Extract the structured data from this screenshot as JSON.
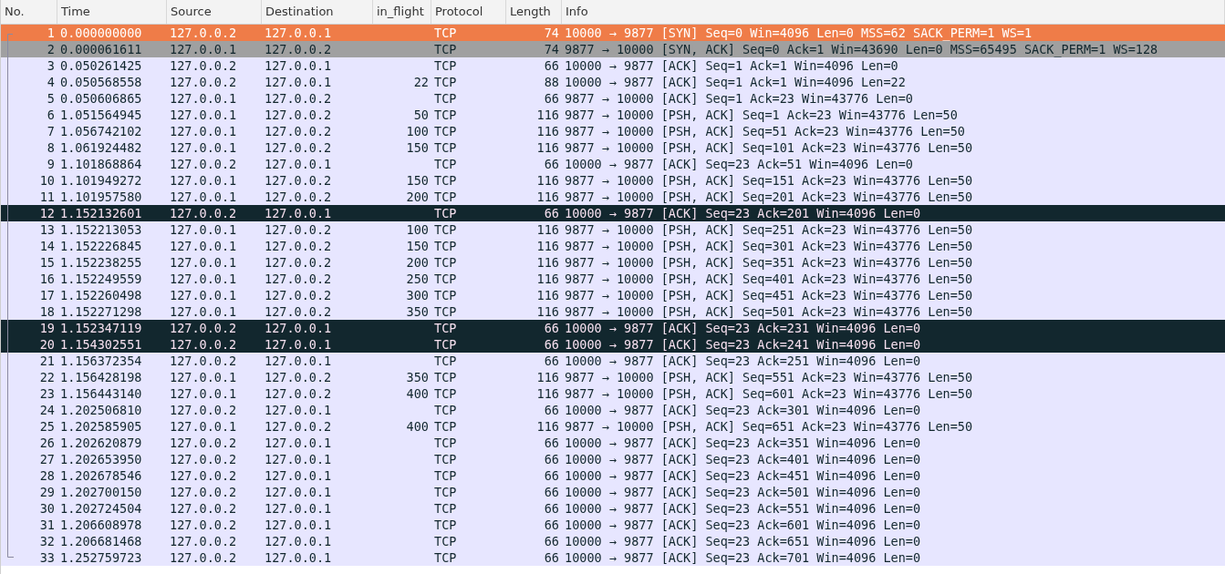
{
  "columns": [
    "No.",
    "Time",
    "Source",
    "Destination",
    "in_flight",
    "Protocol",
    "Length",
    "Info"
  ],
  "rows": [
    {
      "no": "1",
      "time": "0.000000000",
      "source": "127.0.0.2",
      "destination": "127.0.0.1",
      "in_flight": "",
      "protocol": "TCP",
      "length": "74",
      "info": "10000 → 9877 [SYN] Seq=0 Win=4096 Len=0 MSS=62 SACK_PERM=1 WS=1",
      "selected": true
    },
    {
      "no": "2",
      "time": "0.000061611",
      "source": "127.0.0.1",
      "destination": "127.0.0.2",
      "in_flight": "",
      "protocol": "TCP",
      "length": "74",
      "info": "9877 → 10000 [SYN, ACK] Seq=0 Ack=1 Win=43690 Len=0 MSS=65495 SACK_PERM=1 WS=128",
      "kind": "syn",
      "selected": false
    },
    {
      "no": "3",
      "time": "0.050261425",
      "source": "127.0.0.2",
      "destination": "127.0.0.1",
      "in_flight": "",
      "protocol": "TCP",
      "length": "66",
      "info": "10000 → 9877 [ACK] Seq=1 Ack=1 Win=4096 Len=0",
      "kind": "tcp",
      "selected": false
    },
    {
      "no": "4",
      "time": "0.050568558",
      "source": "127.0.0.2",
      "destination": "127.0.0.1",
      "in_flight": "22",
      "protocol": "TCP",
      "length": "88",
      "info": "10000 → 9877 [ACK] Seq=1 Ack=1 Win=4096 Len=22",
      "kind": "tcp",
      "selected": false
    },
    {
      "no": "5",
      "time": "0.050606865",
      "source": "127.0.0.1",
      "destination": "127.0.0.2",
      "in_flight": "",
      "protocol": "TCP",
      "length": "66",
      "info": "9877 → 10000 [ACK] Seq=1 Ack=23 Win=43776 Len=0",
      "kind": "tcp",
      "selected": false
    },
    {
      "no": "6",
      "time": "1.051564945",
      "source": "127.0.0.1",
      "destination": "127.0.0.2",
      "in_flight": "50",
      "protocol": "TCP",
      "length": "116",
      "info": "9877 → 10000 [PSH, ACK] Seq=1 Ack=23 Win=43776 Len=50",
      "kind": "tcp",
      "selected": false
    },
    {
      "no": "7",
      "time": "1.056742102",
      "source": "127.0.0.1",
      "destination": "127.0.0.2",
      "in_flight": "100",
      "protocol": "TCP",
      "length": "116",
      "info": "9877 → 10000 [PSH, ACK] Seq=51 Ack=23 Win=43776 Len=50",
      "kind": "tcp",
      "selected": false
    },
    {
      "no": "8",
      "time": "1.061924482",
      "source": "127.0.0.1",
      "destination": "127.0.0.2",
      "in_flight": "150",
      "protocol": "TCP",
      "length": "116",
      "info": "9877 → 10000 [PSH, ACK] Seq=101 Ack=23 Win=43776 Len=50",
      "kind": "tcp",
      "selected": false
    },
    {
      "no": "9",
      "time": "1.101868864",
      "source": "127.0.0.2",
      "destination": "127.0.0.1",
      "in_flight": "",
      "protocol": "TCP",
      "length": "66",
      "info": "10000 → 9877 [ACK] Seq=23 Ack=51 Win=4096 Len=0",
      "kind": "tcp",
      "selected": false
    },
    {
      "no": "10",
      "time": "1.101949272",
      "source": "127.0.0.1",
      "destination": "127.0.0.2",
      "in_flight": "150",
      "protocol": "TCP",
      "length": "116",
      "info": "9877 → 10000 [PSH, ACK] Seq=151 Ack=23 Win=43776 Len=50",
      "kind": "tcp",
      "selected": false
    },
    {
      "no": "11",
      "time": "1.101957580",
      "source": "127.0.0.1",
      "destination": "127.0.0.2",
      "in_flight": "200",
      "protocol": "TCP",
      "length": "116",
      "info": "9877 → 10000 [PSH, ACK] Seq=201 Ack=23 Win=43776 Len=50",
      "kind": "tcp",
      "selected": false
    },
    {
      "no": "12",
      "time": "1.152132601",
      "source": "127.0.0.2",
      "destination": "127.0.0.1",
      "in_flight": "",
      "protocol": "TCP",
      "length": "66",
      "info": "10000 → 9877 [ACK] Seq=23 Ack=201 Win=4096 Len=0",
      "kind": "bad",
      "selected": false
    },
    {
      "no": "13",
      "time": "1.152213053",
      "source": "127.0.0.1",
      "destination": "127.0.0.2",
      "in_flight": "100",
      "protocol": "TCP",
      "length": "116",
      "info": "9877 → 10000 [PSH, ACK] Seq=251 Ack=23 Win=43776 Len=50",
      "kind": "tcp",
      "selected": false
    },
    {
      "no": "14",
      "time": "1.152226845",
      "source": "127.0.0.1",
      "destination": "127.0.0.2",
      "in_flight": "150",
      "protocol": "TCP",
      "length": "116",
      "info": "9877 → 10000 [PSH, ACK] Seq=301 Ack=23 Win=43776 Len=50",
      "kind": "tcp",
      "selected": false
    },
    {
      "no": "15",
      "time": "1.152238255",
      "source": "127.0.0.1",
      "destination": "127.0.0.2",
      "in_flight": "200",
      "protocol": "TCP",
      "length": "116",
      "info": "9877 → 10000 [PSH, ACK] Seq=351 Ack=23 Win=43776 Len=50",
      "kind": "tcp",
      "selected": false
    },
    {
      "no": "16",
      "time": "1.152249559",
      "source": "127.0.0.1",
      "destination": "127.0.0.2",
      "in_flight": "250",
      "protocol": "TCP",
      "length": "116",
      "info": "9877 → 10000 [PSH, ACK] Seq=401 Ack=23 Win=43776 Len=50",
      "kind": "tcp",
      "selected": false
    },
    {
      "no": "17",
      "time": "1.152260498",
      "source": "127.0.0.1",
      "destination": "127.0.0.2",
      "in_flight": "300",
      "protocol": "TCP",
      "length": "116",
      "info": "9877 → 10000 [PSH, ACK] Seq=451 Ack=23 Win=43776 Len=50",
      "kind": "tcp",
      "selected": false
    },
    {
      "no": "18",
      "time": "1.152271298",
      "source": "127.0.0.1",
      "destination": "127.0.0.2",
      "in_flight": "350",
      "protocol": "TCP",
      "length": "116",
      "info": "9877 → 10000 [PSH, ACK] Seq=501 Ack=23 Win=43776 Len=50",
      "kind": "tcp",
      "selected": false
    },
    {
      "no": "19",
      "time": "1.152347119",
      "source": "127.0.0.2",
      "destination": "127.0.0.1",
      "in_flight": "",
      "protocol": "TCP",
      "length": "66",
      "info": "10000 → 9877 [ACK] Seq=23 Ack=231 Win=4096 Len=0",
      "kind": "bad",
      "selected": false
    },
    {
      "no": "20",
      "time": "1.154302551",
      "source": "127.0.0.2",
      "destination": "127.0.0.1",
      "in_flight": "",
      "protocol": "TCP",
      "length": "66",
      "info": "10000 → 9877 [ACK] Seq=23 Ack=241 Win=4096 Len=0",
      "kind": "bad",
      "selected": false
    },
    {
      "no": "21",
      "time": "1.156372354",
      "source": "127.0.0.2",
      "destination": "127.0.0.1",
      "in_flight": "",
      "protocol": "TCP",
      "length": "66",
      "info": "10000 → 9877 [ACK] Seq=23 Ack=251 Win=4096 Len=0",
      "kind": "tcp",
      "selected": false
    },
    {
      "no": "22",
      "time": "1.156428198",
      "source": "127.0.0.1",
      "destination": "127.0.0.2",
      "in_flight": "350",
      "protocol": "TCP",
      "length": "116",
      "info": "9877 → 10000 [PSH, ACK] Seq=551 Ack=23 Win=43776 Len=50",
      "kind": "tcp",
      "selected": false
    },
    {
      "no": "23",
      "time": "1.156443140",
      "source": "127.0.0.1",
      "destination": "127.0.0.2",
      "in_flight": "400",
      "protocol": "TCP",
      "length": "116",
      "info": "9877 → 10000 [PSH, ACK] Seq=601 Ack=23 Win=43776 Len=50",
      "kind": "tcp",
      "selected": false
    },
    {
      "no": "24",
      "time": "1.202506810",
      "source": "127.0.0.2",
      "destination": "127.0.0.1",
      "in_flight": "",
      "protocol": "TCP",
      "length": "66",
      "info": "10000 → 9877 [ACK] Seq=23 Ack=301 Win=4096 Len=0",
      "kind": "tcp",
      "selected": false
    },
    {
      "no": "25",
      "time": "1.202585905",
      "source": "127.0.0.1",
      "destination": "127.0.0.2",
      "in_flight": "400",
      "protocol": "TCP",
      "length": "116",
      "info": "9877 → 10000 [PSH, ACK] Seq=651 Ack=23 Win=43776 Len=50",
      "kind": "tcp",
      "selected": false
    },
    {
      "no": "26",
      "time": "1.202620879",
      "source": "127.0.0.2",
      "destination": "127.0.0.1",
      "in_flight": "",
      "protocol": "TCP",
      "length": "66",
      "info": "10000 → 9877 [ACK] Seq=23 Ack=351 Win=4096 Len=0",
      "kind": "tcp",
      "selected": false
    },
    {
      "no": "27",
      "time": "1.202653950",
      "source": "127.0.0.2",
      "destination": "127.0.0.1",
      "in_flight": "",
      "protocol": "TCP",
      "length": "66",
      "info": "10000 → 9877 [ACK] Seq=23 Ack=401 Win=4096 Len=0",
      "kind": "tcp",
      "selected": false
    },
    {
      "no": "28",
      "time": "1.202678546",
      "source": "127.0.0.2",
      "destination": "127.0.0.1",
      "in_flight": "",
      "protocol": "TCP",
      "length": "66",
      "info": "10000 → 9877 [ACK] Seq=23 Ack=451 Win=4096 Len=0",
      "kind": "tcp",
      "selected": false
    },
    {
      "no": "29",
      "time": "1.202700150",
      "source": "127.0.0.2",
      "destination": "127.0.0.1",
      "in_flight": "",
      "protocol": "TCP",
      "length": "66",
      "info": "10000 → 9877 [ACK] Seq=23 Ack=501 Win=4096 Len=0",
      "kind": "tcp",
      "selected": false
    },
    {
      "no": "30",
      "time": "1.202724504",
      "source": "127.0.0.2",
      "destination": "127.0.0.1",
      "in_flight": "",
      "protocol": "TCP",
      "length": "66",
      "info": "10000 → 9877 [ACK] Seq=23 Ack=551 Win=4096 Len=0",
      "kind": "tcp",
      "selected": false
    },
    {
      "no": "31",
      "time": "1.206608978",
      "source": "127.0.0.2",
      "destination": "127.0.0.1",
      "in_flight": "",
      "protocol": "TCP",
      "length": "66",
      "info": "10000 → 9877 [ACK] Seq=23 Ack=601 Win=4096 Len=0",
      "kind": "tcp",
      "selected": false
    },
    {
      "no": "32",
      "time": "1.206681468",
      "source": "127.0.0.2",
      "destination": "127.0.0.1",
      "in_flight": "",
      "protocol": "TCP",
      "length": "66",
      "info": "10000 → 9877 [ACK] Seq=23 Ack=651 Win=4096 Len=0",
      "kind": "tcp",
      "selected": false
    },
    {
      "no": "33",
      "time": "1.252759723",
      "source": "127.0.0.2",
      "destination": "127.0.0.1",
      "in_flight": "",
      "protocol": "TCP",
      "length": "66",
      "info": "10000 → 9877 [ACK] Seq=23 Ack=701 Win=4096 Len=0",
      "kind": "tcp",
      "selected": false
    }
  ]
}
